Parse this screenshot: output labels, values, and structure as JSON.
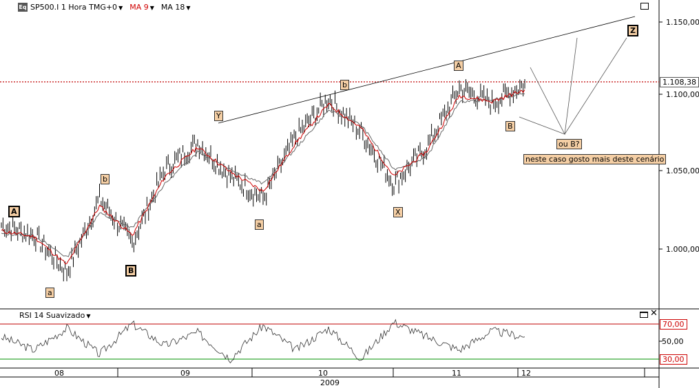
{
  "toolbar": {
    "app_icon": "Eq",
    "instrument": "SP500.I 1 Hora TMG+0",
    "ma9": "MA 9",
    "ma18": "MA 18",
    "ma9_color": "#d00000"
  },
  "price_axis": {
    "ticks": [
      "1.150,00",
      "1.100,00",
      "1.050,00",
      "1.000,00"
    ],
    "current_price": "1.108,38"
  },
  "rsi": {
    "title": "RSI 14 Suavizado",
    "ticks": [
      "70,00",
      "50,00",
      "30,00"
    ],
    "upper_color": "#c00000",
    "lower_color": "#009000"
  },
  "time_axis": {
    "months": [
      "08",
      "09",
      "10",
      "11",
      "12"
    ],
    "year": "2009"
  },
  "waves": {
    "A1": "A",
    "a1": "a",
    "b1": "b",
    "B1": "B",
    "Y": "Y",
    "a2": "a",
    "b2": "b",
    "X": "X",
    "A2": "A",
    "B2": "B",
    "Z": "Z"
  },
  "annotations": {
    "ou_b": "ou B?",
    "note": "neste caso gosto mais deste cenário"
  },
  "chart_data": {
    "type": "line",
    "title": "SP500.I 1 Hora TMG+0",
    "xlabel": "",
    "ylabel": "",
    "x": [
      "08",
      "08",
      "08",
      "08",
      "09",
      "09",
      "09",
      "09",
      "10",
      "10",
      "10",
      "10",
      "11",
      "11",
      "11",
      "11",
      "12"
    ],
    "ylim": [
      955,
      1165
    ],
    "series": [
      {
        "name": "SP500.I",
        "values": [
          1012,
          1005,
          980,
          1030,
          1000,
          1050,
          1068,
          1045,
          1030,
          1072,
          1098,
          1075,
          1040,
          1065,
          1105,
          1095,
          1108
        ]
      },
      {
        "name": "MA 9",
        "values": [
          1008,
          1004,
          985,
          1025,
          1005,
          1045,
          1065,
          1048,
          1035,
          1068,
          1094,
          1078,
          1045,
          1062,
          1100,
          1096,
          1104
        ]
      },
      {
        "name": "MA 18",
        "values": [
          1006,
          1005,
          990,
          1020,
          1010,
          1040,
          1062,
          1050,
          1040,
          1064,
          1090,
          1080,
          1050,
          1058,
          1096,
          1097,
          1101
        ]
      }
    ],
    "rsi_ylim": [
      20,
      80
    ],
    "rsi_levels": [
      70,
      30
    ],
    "rsi_values": [
      55,
      40,
      65,
      35,
      70,
      45,
      60,
      30,
      68,
      40,
      65,
      30,
      72,
      55,
      40,
      62,
      55
    ],
    "current_price": 1108.38,
    "grid": false
  }
}
